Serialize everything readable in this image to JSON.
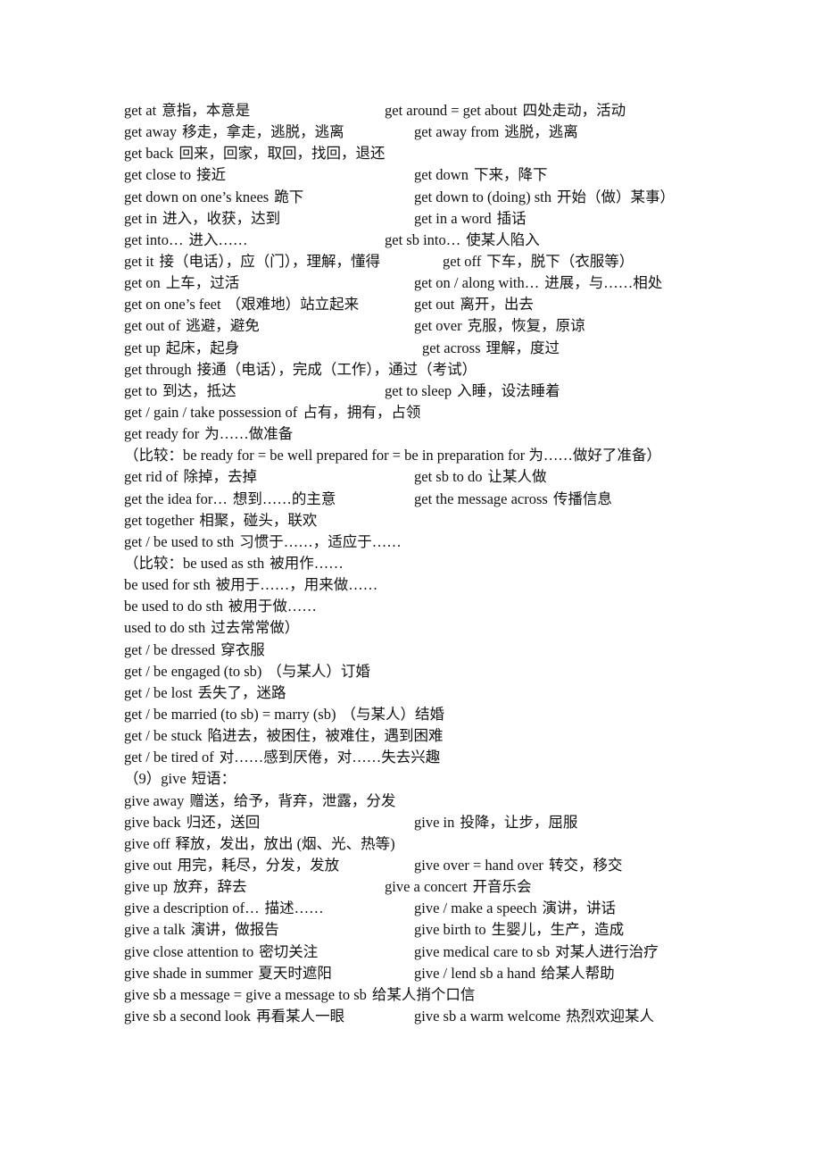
{
  "document": {
    "lines": [
      {
        "left": {
          "en": "get at",
          "zh": "意指，本意是"
        },
        "right": {
          "en": "get around = get about",
          "zh": "四处走动，活动"
        },
        "rcol": "a"
      },
      {
        "left": {
          "en": "get away",
          "zh": "移走，拿走，逃脱，逃离"
        },
        "right": {
          "en": "get away from",
          "zh": "逃脱，逃离"
        },
        "rcol": "b"
      },
      {
        "left": {
          "en": "get back",
          "zh": "回来，回家，取回，找回，退还"
        }
      },
      {
        "left": {
          "en": "get close to",
          "zh": "接近"
        },
        "right": {
          "en": "get down",
          "zh": "下来，降下"
        },
        "rcol": "b"
      },
      {
        "left": {
          "en": "get down on one’s knees",
          "zh": "跪下"
        },
        "right": {
          "en": "get down to (doing) sth",
          "zh": "开始（做）某事）"
        },
        "rcol": "b"
      },
      {
        "left": {
          "en": "get in",
          "zh": "进入，收获，达到"
        },
        "right": {
          "en": "get in a word",
          "zh": "插话"
        },
        "rcol": "b"
      },
      {
        "left": {
          "en": "get into…",
          "zh": "进入……"
        },
        "right": {
          "en": "get sb into…",
          "zh": "使某人陷入"
        },
        "rcol": "a"
      },
      {
        "left": {
          "en": "get it",
          "zh": "接（电话），应（门），理解，懂得"
        },
        "right": {
          "en": "get off",
          "zh": "下车，脱下（衣服等）"
        },
        "rcol": "d"
      },
      {
        "left": {
          "en": "get on",
          "zh": "上车，过活"
        },
        "right": {
          "en": "get on / along with…",
          "zh": "进展，与……相处"
        },
        "rcol": "b"
      },
      {
        "left": {
          "en": "get on one’s feet",
          "zh": "（艰难地）站立起来"
        },
        "right": {
          "en": "get out",
          "zh": "离开，出去"
        },
        "rcol": "b"
      },
      {
        "left": {
          "en": "get out of",
          "zh": "逃避，避免"
        },
        "right": {
          "en": "get over",
          "zh": "克服，恢复，原谅"
        },
        "rcol": "b"
      },
      {
        "left": {
          "en": "get up",
          "zh": "起床，起身"
        },
        "right": {
          "en": "get across",
          "zh": "理解，度过"
        },
        "rcol": "c"
      },
      {
        "left": {
          "en": "get through",
          "zh": "接通（电话），完成（工作），通过（考试）"
        }
      },
      {
        "left": {
          "en": "get to",
          "zh": "到达，抵达"
        },
        "right": {
          "en": "get to sleep",
          "zh": "入睡，设法睡着"
        },
        "rcol": "a"
      },
      {
        "left": {
          "en": "get / gain / take possession of",
          "zh": "占有，拥有，占领"
        }
      },
      {
        "left": {
          "en": "get ready for",
          "zh": "为……做准备"
        }
      },
      {
        "wrap": "（比较：be ready for = be well prepared for = be in preparation for  为……做好了准备）"
      },
      {
        "left": {
          "en": "get rid of",
          "zh": "除掉，去掉"
        },
        "right": {
          "en": "get sb to do",
          "zh": "让某人做"
        },
        "rcol": "b"
      },
      {
        "left": {
          "en": "get the idea for…",
          "zh": "想到……的主意"
        },
        "right": {
          "en": "get the message across",
          "zh": "传播信息"
        },
        "rcol": "b"
      },
      {
        "left": {
          "en": "get together",
          "zh": "相聚，碰头，联欢"
        }
      },
      {
        "left": {
          "en": "get / be used to sth",
          "zh": "习惯于……，适应于……"
        }
      },
      {
        "left": {
          "en": "（比较：be used as sth",
          "zh": "被用作……"
        }
      },
      {
        "left": {
          "en": "be used for sth",
          "zh": "被用于……，用来做……"
        }
      },
      {
        "left": {
          "en": "be used to do sth",
          "zh": "被用于做……"
        }
      },
      {
        "left": {
          "en": "used to do sth",
          "zh": "过去常常做）"
        }
      },
      {
        "left": {
          "en": "get / be dressed",
          "zh": "穿衣服"
        }
      },
      {
        "left": {
          "en": "get / be engaged (to sb)",
          "zh": "（与某人）订婚"
        }
      },
      {
        "left": {
          "en": "get / be lost",
          "zh": "丢失了，迷路"
        }
      },
      {
        "left": {
          "en": "get / be married (to sb) = marry (sb)",
          "zh": "（与某人）结婚"
        }
      },
      {
        "left": {
          "en": "get / be stuck",
          "zh": "陷进去，被困住，被难住，遇到困难"
        }
      },
      {
        "left": {
          "en": "get / be tired of",
          "zh": "对……感到厌倦，对……失去兴趣"
        }
      },
      {
        "left": {
          "en": "（9）give",
          "zh": "短语："
        }
      },
      {
        "left": {
          "en": "give away",
          "zh": "赠送，给予，背弃，泄露，分发"
        }
      },
      {
        "left": {
          "en": "give back",
          "zh": "归还，送回"
        },
        "right": {
          "en": "give in",
          "zh": "投降，让步，屈服"
        },
        "rcol": "b"
      },
      {
        "left": {
          "en": "give off",
          "zh": "释放，发出，放出 (烟、光、热等)"
        }
      },
      {
        "left": {
          "en": "give out",
          "zh": "用完，耗尽，分发，发放"
        },
        "right": {
          "en": "give over = hand over",
          "zh": "转交，移交"
        },
        "rcol": "b"
      },
      {
        "left": {
          "en": "give up",
          "zh": "放弃，辞去"
        },
        "right": {
          "en": "give a concert",
          "zh": "开音乐会"
        },
        "rcol": "a"
      },
      {
        "left": {
          "en": "give a description of…",
          "zh": "描述……"
        },
        "right": {
          "en": "give / make a speech",
          "zh": "演讲，讲话"
        },
        "rcol": "b"
      },
      {
        "left": {
          "en": "give a talk",
          "zh": "演讲，做报告"
        },
        "right": {
          "en": "give birth to",
          "zh": "生婴儿，生产，造成"
        },
        "rcol": "b"
      },
      {
        "left": {
          "en": "give close attention to",
          "zh": "密切关注"
        },
        "right": {
          "en": "give medical care to sb",
          "zh": "对某人进行治疗"
        },
        "rcol": "b"
      },
      {
        "left": {
          "en": "give shade in summer",
          "zh": "夏天时遮阳"
        },
        "right": {
          "en": "give / lend sb a hand",
          "zh": "给某人帮助"
        },
        "rcol": "b"
      },
      {
        "left": {
          "en": "give sb a message = give a message to sb",
          "zh": "给某人捎个口信"
        }
      },
      {
        "left": {
          "en": "give sb a second look",
          "zh": "再看某人一眼"
        },
        "right": {
          "en": "give sb a warm welcome",
          "zh": "热烈欢迎某人"
        },
        "rcol": "b"
      }
    ]
  }
}
